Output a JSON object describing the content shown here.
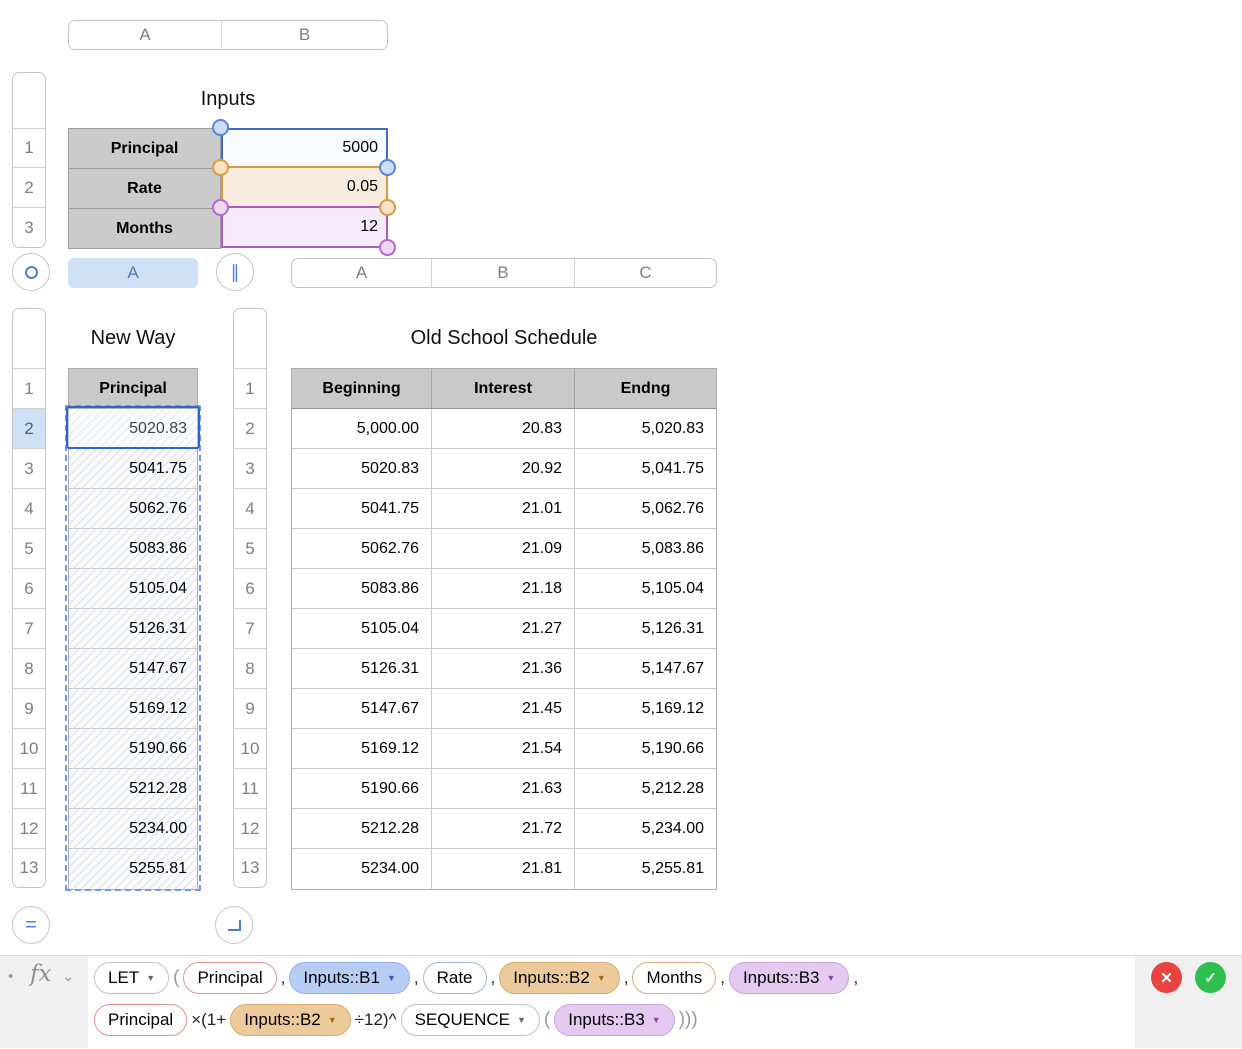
{
  "inputs": {
    "title": "Inputs",
    "col_letters": [
      "A",
      "B"
    ],
    "row_numbers": [
      "1",
      "2",
      "3"
    ],
    "rows": [
      {
        "label": "Principal",
        "value": "5000"
      },
      {
        "label": "Rate",
        "value": "0.05"
      },
      {
        "label": "Months",
        "value": "12"
      }
    ]
  },
  "new_way": {
    "title": "New Way",
    "col_letter": "A",
    "header": "Principal",
    "row_numbers": [
      "1",
      "2",
      "3",
      "4",
      "5",
      "6",
      "7",
      "8",
      "9",
      "10",
      "11",
      "12",
      "13"
    ],
    "values": [
      "5020.83",
      "5041.75",
      "5062.76",
      "5083.86",
      "5105.04",
      "5126.31",
      "5147.67",
      "5169.12",
      "5190.66",
      "5212.28",
      "5234.00",
      "5255.81"
    ]
  },
  "old_school": {
    "title": "Old School Schedule",
    "col_letters": [
      "A",
      "B",
      "C"
    ],
    "row_numbers": [
      "1",
      "2",
      "3",
      "4",
      "5",
      "6",
      "7",
      "8",
      "9",
      "10",
      "11",
      "12",
      "13"
    ],
    "headers": [
      "Beginning",
      "Interest",
      "Endng"
    ],
    "rows": [
      [
        "5,000.00",
        "20.83",
        "5,020.83"
      ],
      [
        "5020.83",
        "20.92",
        "5,041.75"
      ],
      [
        "5041.75",
        "21.01",
        "5,062.76"
      ],
      [
        "5062.76",
        "21.09",
        "5,083.86"
      ],
      [
        "5083.86",
        "21.18",
        "5,105.04"
      ],
      [
        "5105.04",
        "21.27",
        "5,126.31"
      ],
      [
        "5126.31",
        "21.36",
        "5,147.67"
      ],
      [
        "5147.67",
        "21.45",
        "5,169.12"
      ],
      [
        "5169.12",
        "21.54",
        "5,190.66"
      ],
      [
        "5190.66",
        "21.63",
        "5,212.28"
      ],
      [
        "5212.28",
        "21.72",
        "5,234.00"
      ],
      [
        "5234.00",
        "21.81",
        "5,255.81"
      ]
    ]
  },
  "formula_bar": {
    "fx_label": "fx",
    "line1": {
      "let": "LET",
      "open_paren": "(",
      "var1": "Principal",
      "comma1": ",",
      "ref1": "Inputs::B1",
      "comma2": ",",
      "var2": "Rate",
      "comma3": ",",
      "ref2": "Inputs::B2",
      "comma4": ",",
      "var3": "Months",
      "comma5": ",",
      "ref3": "Inputs::B3",
      "comma6": ","
    },
    "line2": {
      "var1": "Principal",
      "op1": "×(1+",
      "ref1": "Inputs::B2",
      "op2": "÷12)^",
      "func": "SEQUENCE",
      "open_paren": "(",
      "ref2": "Inputs::B3",
      "close_parens": ")))"
    }
  },
  "icons": {
    "dropdown": "▼",
    "chevron_down": "⌄",
    "dot": "•",
    "close": "✕",
    "confirm": "✓",
    "table_handle": "○",
    "column_resize": "∥",
    "row_resize": "="
  },
  "colors": {
    "reference_blue": "#3f6cc8",
    "reference_orange": "#dd9a3c",
    "reference_purple": "#ab5cc4",
    "selection_blue": "#2e62d9",
    "cancel_red": "#e8433e",
    "accept_green": "#2fbf4f"
  }
}
